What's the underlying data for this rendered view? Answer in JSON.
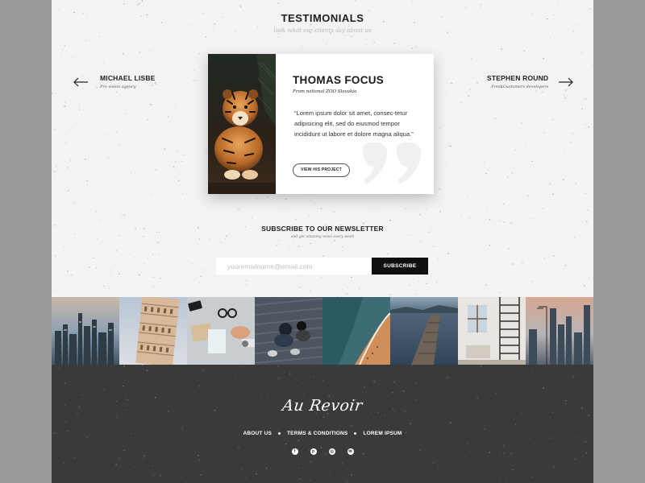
{
  "testimonials": {
    "title": "TESTIMONIALS",
    "subtitle": "look what our clients say about us",
    "prev": {
      "name": "MICHAEL LISBE",
      "company": "Pro vision agency"
    },
    "next": {
      "name": "STEPHEN ROUND",
      "company": "FreshCustomers developers"
    },
    "current": {
      "name": "THOMAS FOCUS",
      "company": "From national ZOO Slovakia",
      "quote": "“Lorem ipsum dolor sit amet, consec-tetur adipisicing elit, sed do eiusmod tempor incididunt ut labore et dolore magna aliqua.”",
      "button_label": "VIEW HIS PROJECT",
      "photo_icon": "tiger-photo"
    }
  },
  "newsletter": {
    "title": "SUBSCRIBE TO OUR NEWSLETTER",
    "subtitle": "and get amazing news every week",
    "placeholder": "youremailname@email.com",
    "button_label": "SUBSCRIBE"
  },
  "gallery": {
    "images": [
      "city-skyline-photo",
      "leaning-tower-photo",
      "desk-items-photo",
      "sitting-people-photo",
      "coastline-aerial-photo",
      "pier-lake-photo",
      "loft-stairs-photo",
      "downtown-towers-photo"
    ]
  },
  "footer": {
    "signature": "Au Revoir",
    "links": [
      "ABOUT US",
      "TERMS & CONDITIONS",
      "LOREM IPSUM"
    ],
    "social_icons": [
      "facebook-icon",
      "pinterest-icon",
      "instagram-icon",
      "messenger-icon"
    ],
    "social_glyphs": [
      "f",
      "p",
      "◎",
      "✉"
    ]
  },
  "colors": {
    "page_bg": "#f3f3f3",
    "footer_bg": "#3a3a3a",
    "accent": "#0f0f0f",
    "outer_bg": "#9a9a9a"
  }
}
